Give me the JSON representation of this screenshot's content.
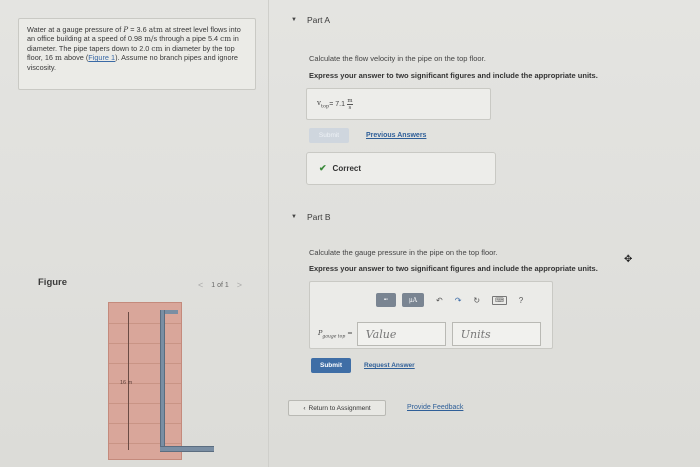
{
  "problem": {
    "text_1": "Water at a gauge pressure of ",
    "var_p": "P",
    "text_2": " = 3.6 ",
    "unit_atm": "atm",
    "text_3": " at street level flows into an office building at a speed of 0.98 ",
    "unit_speed": "m/s",
    "text_4": " through a pipe 5.4 ",
    "unit_cm1": "cm",
    "text_5": " in diameter. The pipe tapers down to 2.0 ",
    "unit_cm2": "cm",
    "text_6": " in diameter by the top floor, 16 ",
    "unit_m": "m",
    "text_7": " above (",
    "figure_link": "Figure 1",
    "text_8": "). Assume no branch pipes and ignore viscosity."
  },
  "figure": {
    "label": "Figure",
    "counter": "1 of 1",
    "prev": "<",
    "next": ">",
    "height_label": "16 m"
  },
  "part_a": {
    "title": "Part A",
    "instruction": "Calculate the flow velocity in the pipe on the top floor.",
    "instruction_bold": "Express your answer to two significant figures and include the appropriate units.",
    "answer_var": "v",
    "answer_sub": "top",
    "answer_eq": " = 7.1 ",
    "answer_unit_num": "m",
    "answer_unit_den": "s",
    "submit_label": "Submit",
    "previous_answers": "Previous Answers",
    "status": "Correct"
  },
  "part_b": {
    "title": "Part B",
    "instruction": "Calculate the gauge pressure in the pipe on the top floor.",
    "instruction_bold": "Express your answer to two significant figures and include the appropriate units.",
    "input_var": "P",
    "input_sub": "gauge top",
    "input_eq": " = ",
    "value_placeholder": "Value",
    "units_placeholder": "Units",
    "toolbar_mu": "μA",
    "submit_label": "Submit",
    "request_answer": "Request Answer"
  },
  "footer": {
    "return_label": "Return to Assignment",
    "feedback_label": "Provide Feedback"
  }
}
